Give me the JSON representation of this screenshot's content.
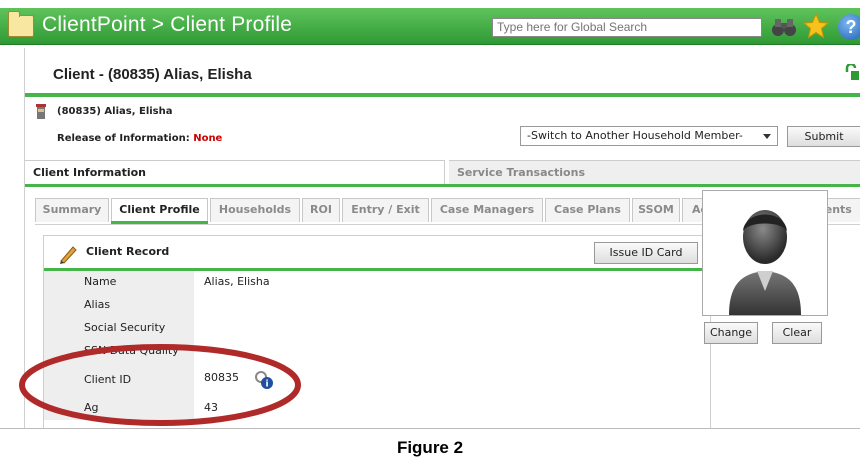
{
  "app": {
    "title": "ClientPoint > Client Profile"
  },
  "search": {
    "placeholder": "Type here for Global Search"
  },
  "header": {
    "client_title": "Client - (80835) Alias, Elisha",
    "record_name": "(80835) Alias, Elisha",
    "roi_label": "Release of Information:",
    "roi_value": "None"
  },
  "household": {
    "selected": "-Switch to Another Household Member-",
    "submit_label": "Submit"
  },
  "main_tabs": [
    {
      "label": "Client Information",
      "active": true
    },
    {
      "label": "Service Transactions",
      "active": false
    }
  ],
  "sub_tabs": [
    {
      "label": "Summary"
    },
    {
      "label": "Client Profile",
      "active": true
    },
    {
      "label": "Households"
    },
    {
      "label": "ROI"
    },
    {
      "label": "Entry / Exit"
    },
    {
      "label": "Case Managers"
    },
    {
      "label": "Case Plans"
    },
    {
      "label": "SSOM"
    },
    {
      "label": "Activities"
    },
    {
      "label": "Assessments"
    }
  ],
  "record": {
    "title": "Client Record",
    "issue_label": "Issue ID Card",
    "fields": [
      {
        "label": "Name",
        "value": "Alias, Elisha"
      },
      {
        "label": "Alias",
        "value": ""
      },
      {
        "label": "Social Security",
        "value": ""
      },
      {
        "label": "SSN Data Quality",
        "value": ""
      },
      {
        "label": "Client ID",
        "value": "80835"
      },
      {
        "label": "Ag",
        "value": "43"
      }
    ]
  },
  "photo": {
    "change_label": "Change",
    "clear_label": "Clear"
  },
  "caption": "Figure 2",
  "colors": {
    "brand_green": "#46b549",
    "roi_red": "#cc0000",
    "highlight_ellipse": "#b02a2a"
  }
}
